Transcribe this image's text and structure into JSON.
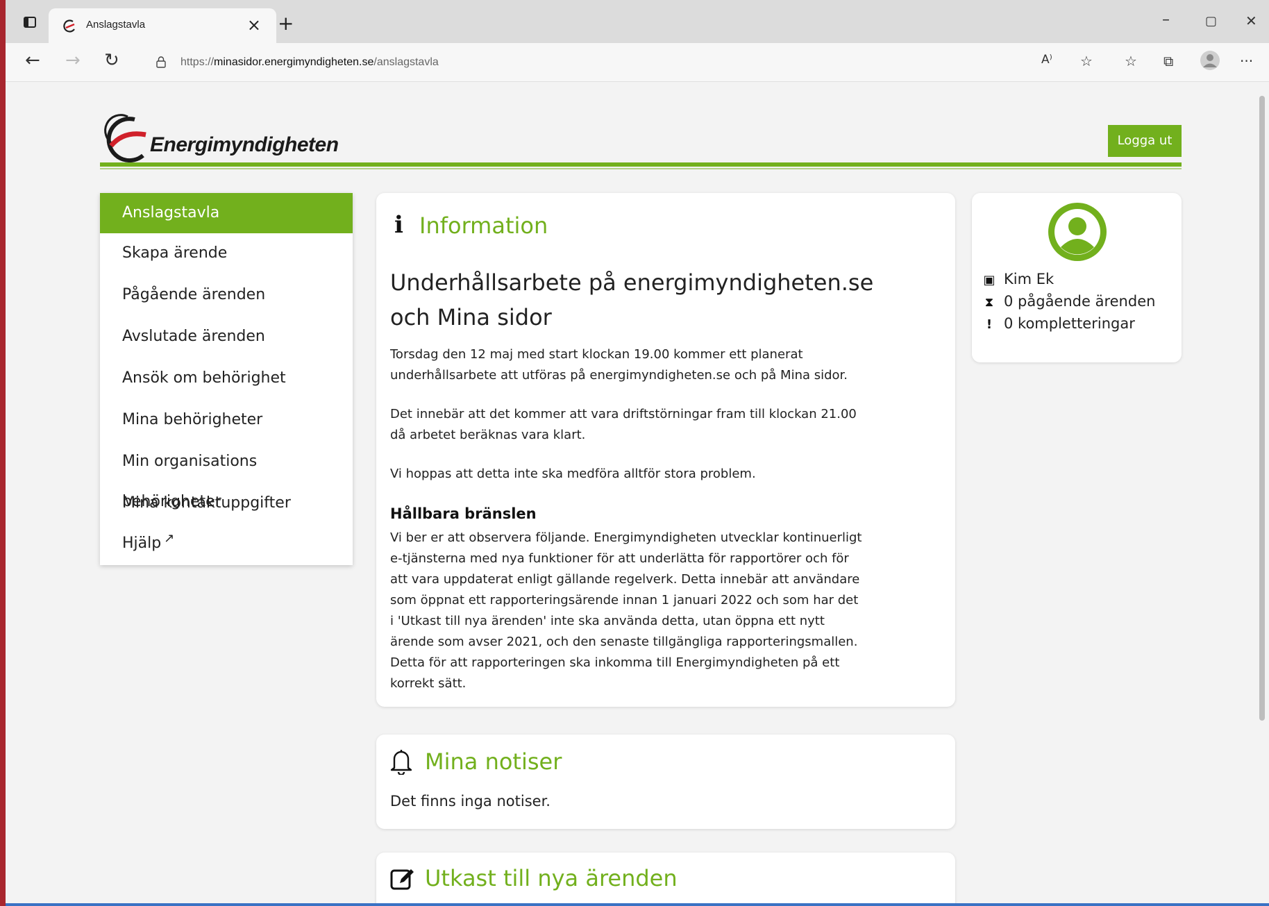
{
  "browser": {
    "tab_title": "Anslagstavla",
    "tab_close": "×",
    "new_tab": "+",
    "url_prefix": "https://",
    "url_domain": "minasidor.energimyndigheten.se",
    "url_path": "/anslagstavla",
    "minimize": "–",
    "maximize": "▢",
    "close": "✕",
    "back": "←",
    "forward": "→",
    "reload": "↻",
    "read_aloud": "A⁾",
    "more": "···"
  },
  "site": {
    "logo_text": "Energimyndigheten",
    "logout_label": "Logga ut",
    "brand_color": "#72b01d"
  },
  "sidebar": {
    "items": [
      {
        "label": "Anslagstavla",
        "active": true
      },
      {
        "label": "Skapa ärende"
      },
      {
        "label": "Pågående ärenden"
      },
      {
        "label": "Avslutade ärenden"
      },
      {
        "label": "Ansök om behörighet"
      },
      {
        "label": "Mina behörigheter"
      },
      {
        "label": "Min organisations behörigheter"
      },
      {
        "label": "Mina kontaktuppgifter"
      },
      {
        "label": "Hjälp",
        "external": true
      }
    ]
  },
  "info": {
    "icon": "i",
    "title": "Information",
    "subject_line1": "Underhållsarbete på energimyndigheten.se",
    "subject_line2": "och Mina sidor",
    "p1_line1": "Torsdag den 12 maj med start klockan 19.00 kommer ett planerat",
    "p1_line2": "underhållsarbete att utföras på energimyndigheten.se och på Mina sidor.",
    "p2_line1": "Det innebär att det kommer att vara driftstörningar fram till klockan 21.00",
    "p2_line2": "då arbetet beräknas vara klart.",
    "p3": "Vi hoppas att detta inte ska medföra alltför stora problem.",
    "sub_heading": "Hållbara bränslen",
    "p4_lines": [
      "Vi ber er att observera följande. Energimyndigheten utvecklar kontinuerligt",
      "e-tjänsterna med nya funktioner för att underlätta för rapportörer och för",
      "att vara uppdaterat enligt gällande regelverk. Detta innebär att användare",
      "som öppnat ett rapporteringsärende innan 1 januari 2022 och som har det",
      "i 'Utkast till nya ärenden' inte ska använda detta, utan öppna ett nytt",
      "ärende som avser 2021, och den senaste tillgängliga rapporteringsmallen.",
      "Detta för att rapporteringen ska inkomma till Energimyndigheten på ett",
      "korrekt sätt."
    ]
  },
  "notiser": {
    "title": "Mina notiser",
    "message": "Det finns inga notiser."
  },
  "drafts": {
    "title": "Utkast till nya ärenden"
  },
  "user": {
    "name": "Kim Ek",
    "ongoing": "0 pågående ärenden",
    "completions": "0 kompletteringar",
    "name_icon": "🪪",
    "ongoing_icon": "⧗",
    "completions_icon": "!"
  }
}
